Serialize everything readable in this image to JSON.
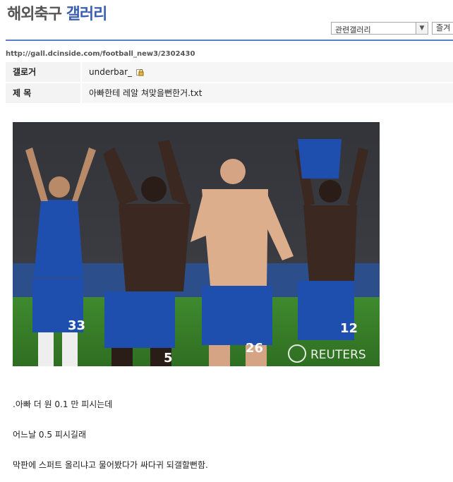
{
  "header": {
    "title_part1": "해외축구",
    "title_part2": "갤러리",
    "related_select": "관련갤러리",
    "fav_label": "즐겨"
  },
  "post": {
    "url": "http://gall.dcinside.com/football_new3/2302430",
    "author_label": "갤로거",
    "author": "underbar_",
    "subject_label": "제 목",
    "subject": "아빠한테 레알 쳐맞을뻔한거.txt"
  },
  "photo": {
    "watermark": "REUTERS",
    "jersey_numbers": [
      "33",
      "5",
      "26",
      "12"
    ]
  },
  "body_lines": [
    ".아빠 더 원 0.1 만 피시는데",
    "어느날 0.5 피시길래",
    "막판에 스퍼트 올리냐고 물어봤다가 싸다귀 되갤할뻔함."
  ],
  "colors": {
    "accent": "#3b5fb0",
    "rule": "#5a7ec7"
  }
}
